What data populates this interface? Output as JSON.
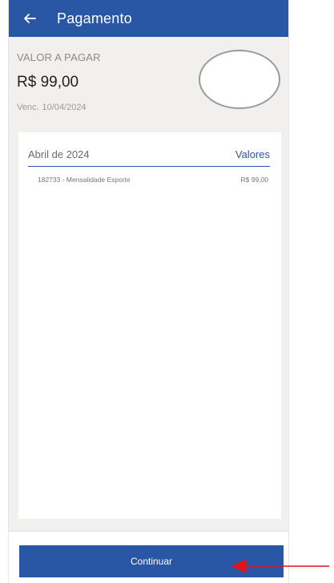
{
  "header": {
    "title": "Pagamento",
    "back_icon": "arrow-left-icon",
    "background": "#2a56a6"
  },
  "summary": {
    "label": "VALOR A PAGAR",
    "amount": "R$ 99,00",
    "due_label": "Venc.",
    "due_date": "10/04/2024"
  },
  "details": {
    "month": "Abril de 2024",
    "values_link": "Valores",
    "items": [
      {
        "description": "182733 - Mensalidade Esporte",
        "value": "R$ 99,00"
      }
    ]
  },
  "footer": {
    "continue_label": "Continuar"
  },
  "annotation": {
    "arrow_color": "#e0151b"
  }
}
